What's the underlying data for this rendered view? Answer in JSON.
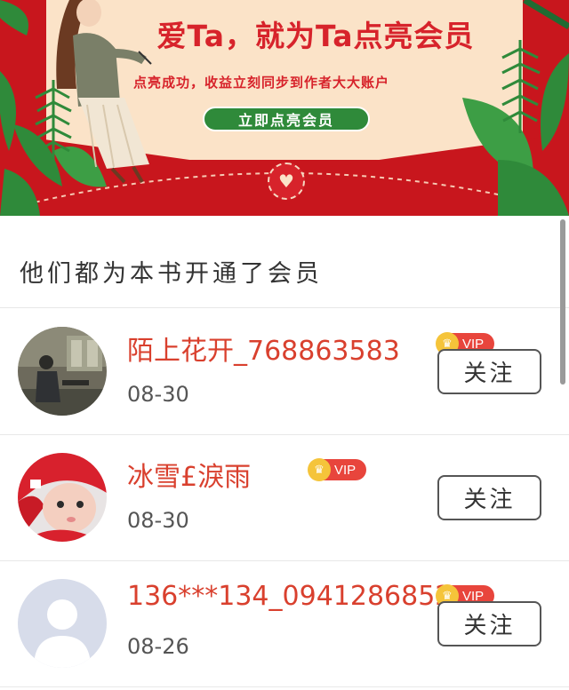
{
  "banner": {
    "title": "爱Ta，就为Ta点亮会员",
    "subtitle": "点亮成功，收益立刻同步到作者大大账户",
    "cta_label": "立即点亮会员",
    "colors": {
      "background": "#c8161d",
      "card": "#fbe3c8",
      "cta": "#2f8a3a",
      "title": "#d7232b"
    }
  },
  "section": {
    "title": "他们都为本书开通了会员"
  },
  "members": [
    {
      "name": "陌上花开_768863583",
      "date": "08-30",
      "vip_label": "VIP",
      "follow_label": "关注",
      "avatar": "photo-avatar"
    },
    {
      "name": "冰雪£淚雨",
      "date": "08-30",
      "vip_label": "VIP",
      "follow_label": "关注",
      "avatar": "baby-photo-avatar"
    },
    {
      "name": "136***134_0941286852",
      "date": "08-26",
      "vip_label": "VIP",
      "follow_label": "关注",
      "avatar": "default-user-avatar"
    }
  ],
  "icons": {
    "vip": "crown-icon",
    "seal": "heart-icon"
  }
}
